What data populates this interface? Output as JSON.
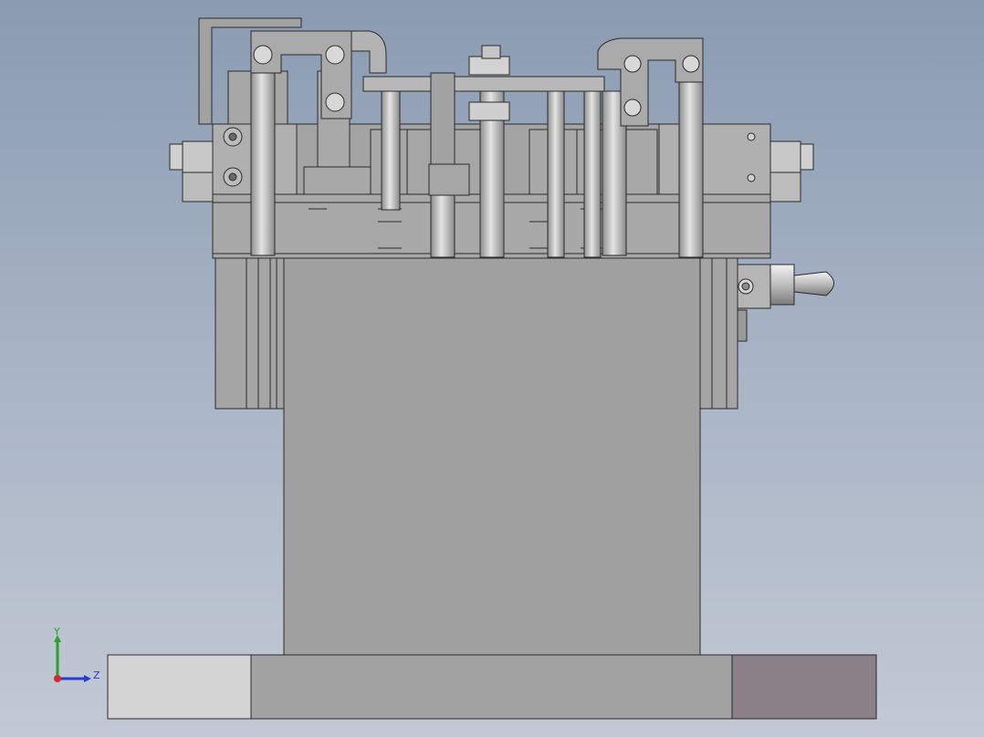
{
  "viewport": {
    "background_top": "#8a9bb2",
    "background_bottom": "#c2c9d4",
    "part_color": "#a0a0a0",
    "part_light_color": "#c8c8c8",
    "edge_color": "#2a2a2a"
  },
  "base_plate": {
    "left_segment_color": "#d4d4d4",
    "middle_segment_color": "#a3a3a3",
    "right_segment_color": "#8c8088"
  },
  "triad": {
    "y_label": "Y",
    "z_label": "Z",
    "y_color": "#2aa02a",
    "z_color": "#2a3ad0",
    "x_color": "#d02a2a"
  }
}
